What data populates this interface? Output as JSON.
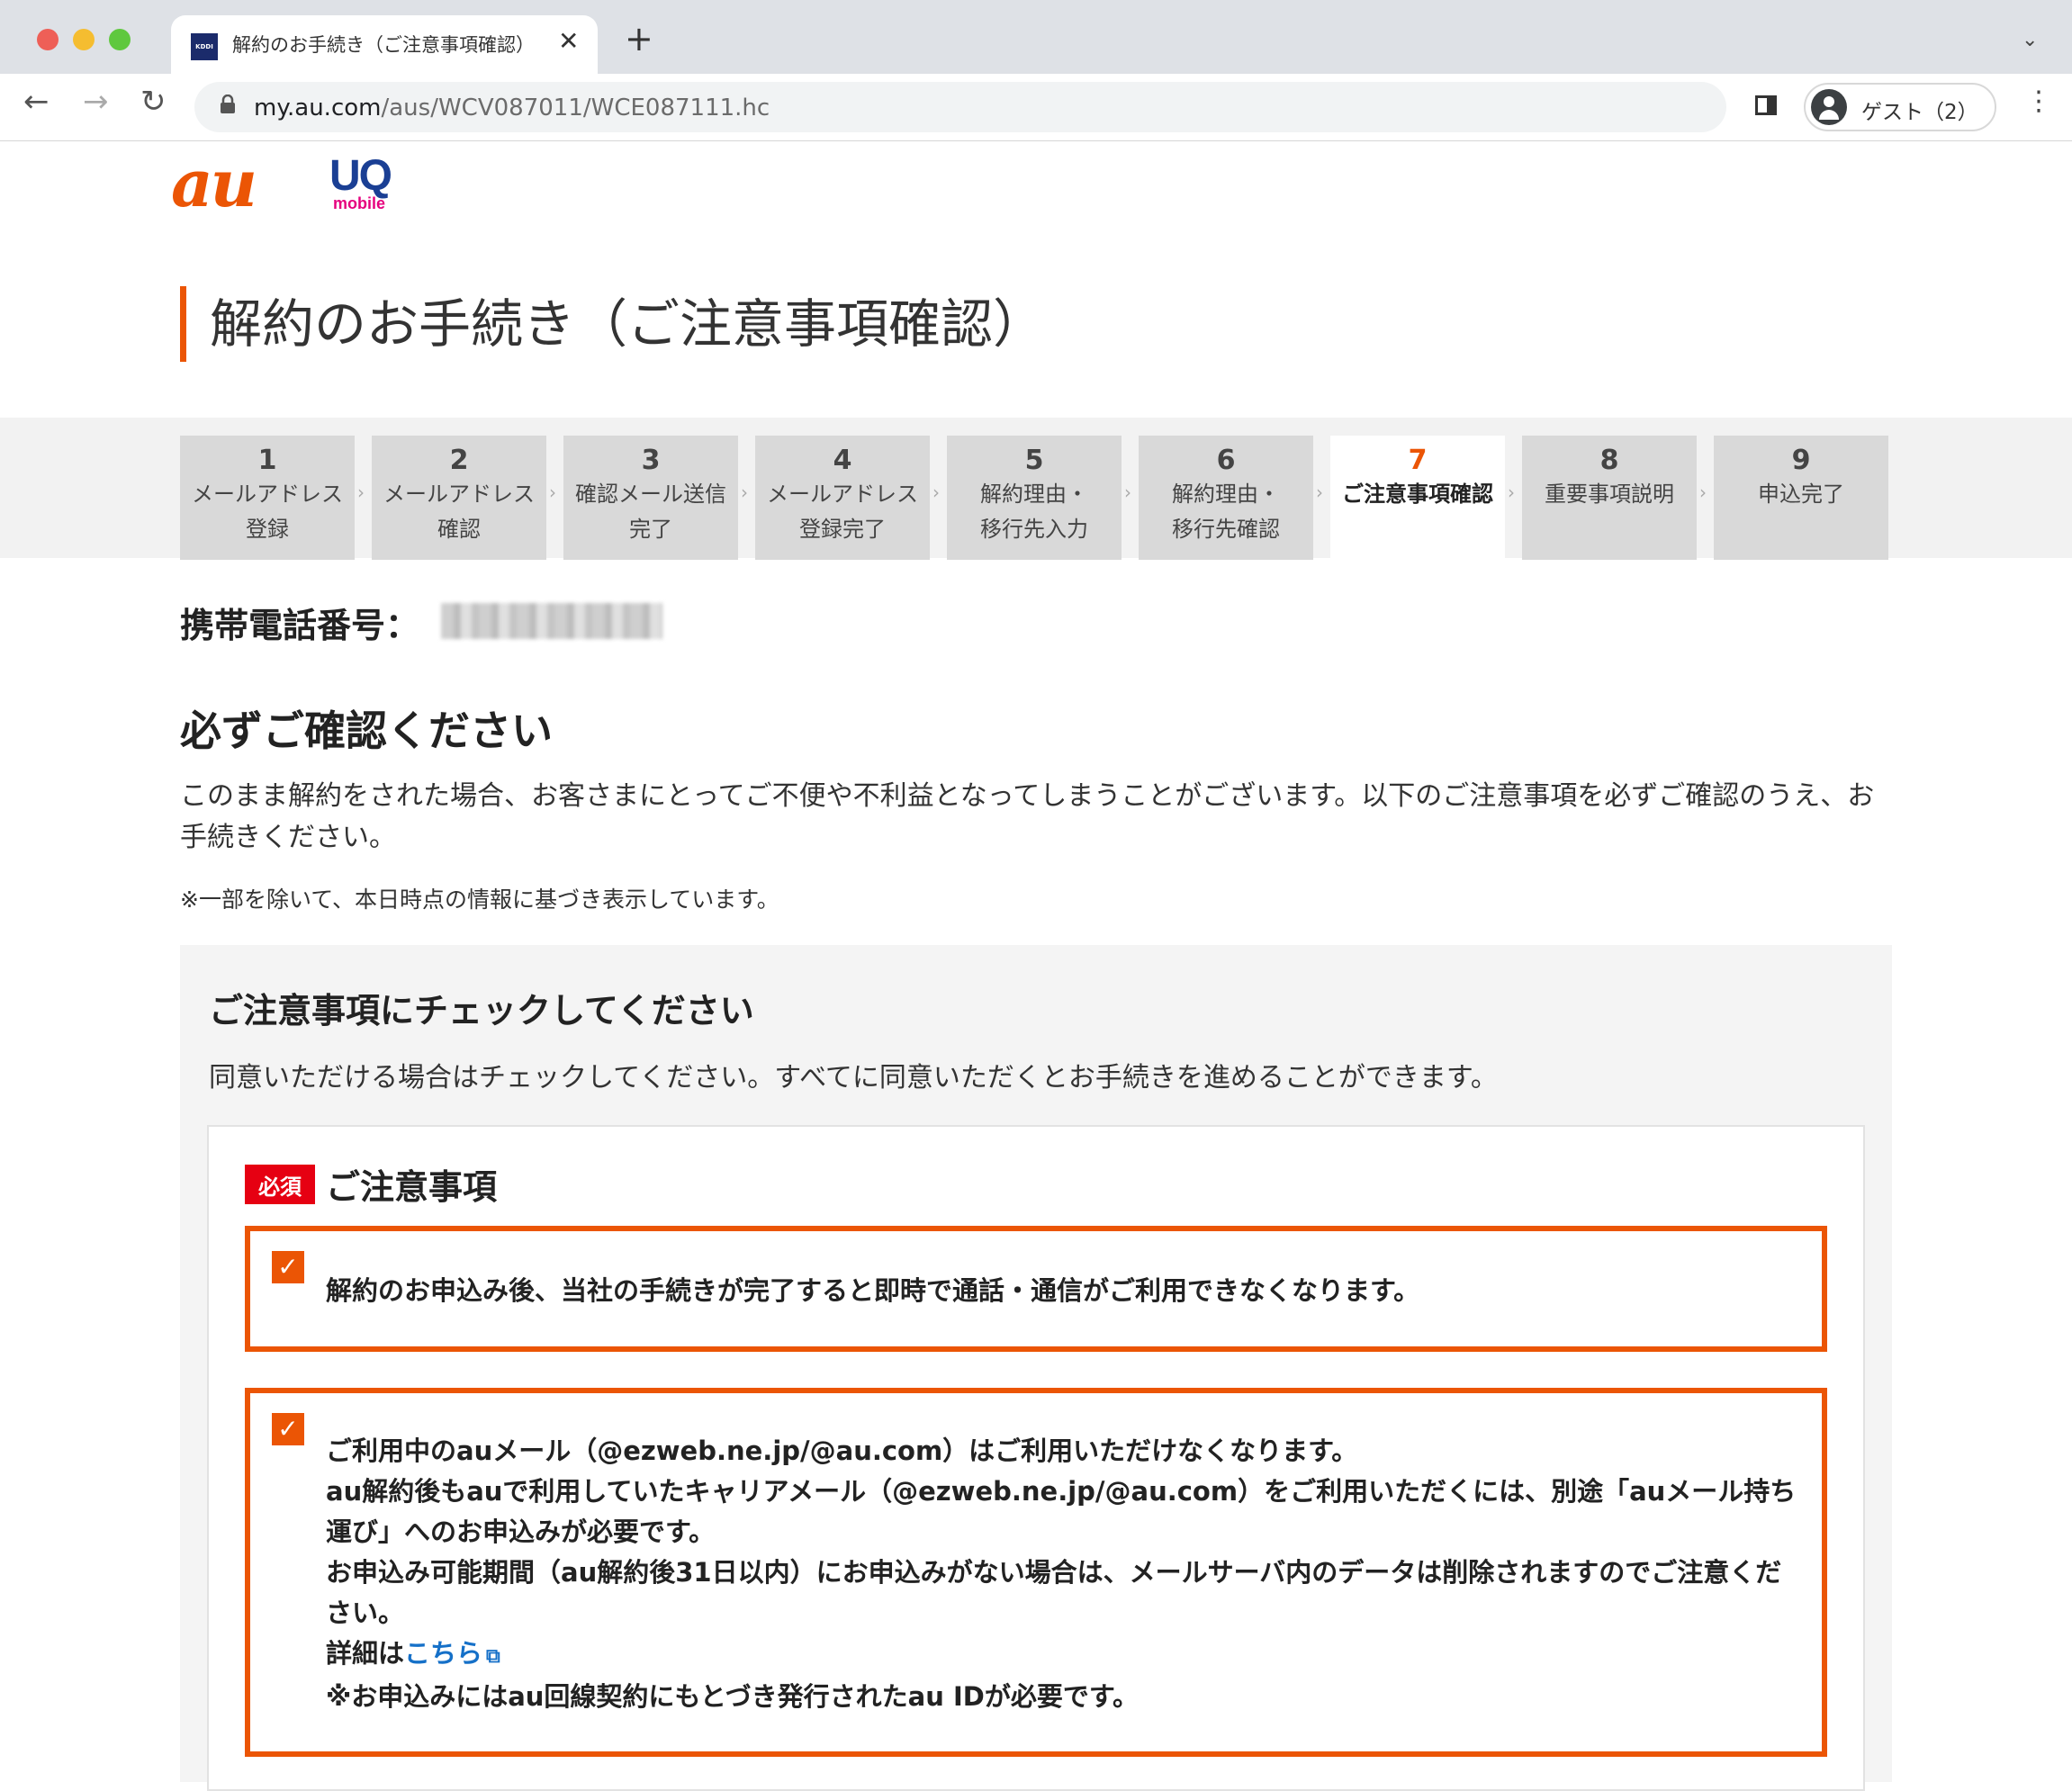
{
  "browser": {
    "tab": {
      "favicon_text": "KDDI",
      "title": "解約のお手続き（ご注意事項確認）",
      "close_glyph": "✕"
    },
    "new_tab_glyph": "+",
    "tab_menu_glyph": "⌄",
    "nav": {
      "back_glyph": "←",
      "forward_glyph": "→",
      "reload_glyph": "↻"
    },
    "url": {
      "host": "my.au.com",
      "path": "/aus/WCV087011/WCE087111.hc"
    },
    "profile_label": "ゲスト（2）",
    "menu_glyph": "⋮"
  },
  "logos": {
    "au": "au",
    "uq": "UQ",
    "uq_sub": "mobile"
  },
  "page_title": "解約のお手続き（ご注意事項確認）",
  "steps": [
    {
      "num": "1",
      "label": "メールアドレス\n登録",
      "current": false
    },
    {
      "num": "2",
      "label": "メールアドレス\n確認",
      "current": false
    },
    {
      "num": "3",
      "label": "確認メール送信\n完了",
      "current": false
    },
    {
      "num": "4",
      "label": "メールアドレス\n登録完了",
      "current": false
    },
    {
      "num": "5",
      "label": "解約理由・\n移行先入力",
      "current": false
    },
    {
      "num": "6",
      "label": "解約理由・\n移行先確認",
      "current": false
    },
    {
      "num": "7",
      "label": "ご注意事項確認",
      "current": true
    },
    {
      "num": "8",
      "label": "重要事項説明",
      "current": false
    },
    {
      "num": "9",
      "label": "申込完了",
      "current": false
    }
  ],
  "step_separator": "›",
  "phone": {
    "label": "携帯電話番号："
  },
  "confirm": {
    "title": "必ずご確認ください",
    "intro": "このまま解約をされた場合、お客さまにとってご不便や不利益となってしまうことがございます。以下のご注意事項を必ずご確認のうえ、お手続きください。",
    "note": "※一部を除いて、本日時点の情報に基づき表示しています。"
  },
  "check_panel": {
    "title": "ご注意事項にチェックしてください",
    "description": "同意いただける場合はチェックしてください。すべてに同意いただくとお手続きを進めることができます。",
    "required_badge": "必須",
    "heading": "ご注意事項",
    "items": [
      {
        "checked": true,
        "text": "解約のお申込み後、当社の手続きが完了すると即時で通話・通信がご利用できなくなります。"
      },
      {
        "checked": true,
        "line1": "ご利用中のauメール（@ezweb.ne.jp/@au.com）はご利用いただけなくなります。",
        "line2": "au解約後もauで利用していたキャリアメール（@ezweb.ne.jp/@au.com）をご利用いただくには、別途「auメール持ち運び」へのお申込みが必要です。",
        "line3": "お申込み可能期間（au解約後31日以内）にお申込みがない場合は、メールサーバ内のデータは削除されますのでご注意ください。",
        "detail_prefix": "詳細は",
        "detail_link": "こちら",
        "line5": "※お申込みにはau回線契約にもとづき発行されたau IDが必要です。"
      }
    ],
    "check_glyph": "✓",
    "external_link_glyph": "⧉"
  },
  "colors": {
    "accent": "#eb5505",
    "required": "#e60012",
    "link": "#1570c8",
    "uq_blue": "#1a3f94",
    "uq_pink": "#e6007e"
  }
}
